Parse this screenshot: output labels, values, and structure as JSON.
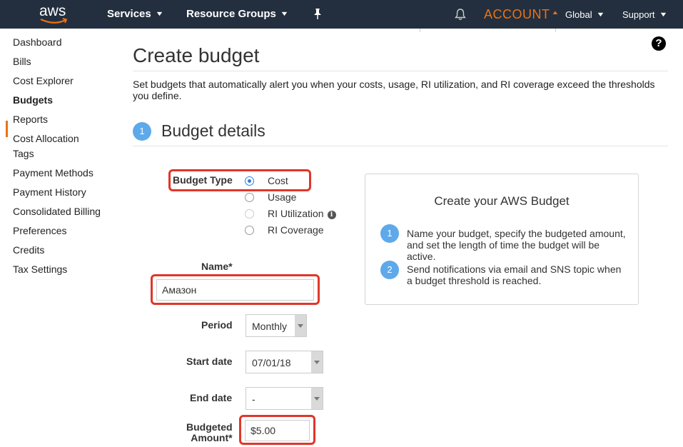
{
  "topnav": {
    "logo_text": "aws",
    "services": "Services",
    "resource_groups": "Resource Groups",
    "account": "ACCOUNT",
    "region": "Global",
    "support": "Support"
  },
  "sidebar": {
    "items": [
      {
        "label": "Dashboard"
      },
      {
        "label": "Bills"
      },
      {
        "label": "Cost Explorer"
      },
      {
        "label": "Budgets",
        "active": true
      },
      {
        "label": "Reports"
      },
      {
        "label": "Cost Allocation Tags"
      },
      {
        "label": "Payment Methods"
      },
      {
        "label": "Payment History"
      },
      {
        "label": "Consolidated Billing"
      },
      {
        "label": "Preferences"
      },
      {
        "label": "Credits"
      },
      {
        "label": "Tax Settings"
      }
    ]
  },
  "help": "?",
  "page": {
    "title": "Create budget",
    "description": "Set budgets that automatically alert you when your costs, usage, RI utilization, and RI coverage exceed the thresholds you define.",
    "section_number": "1",
    "section_title": "Budget details"
  },
  "form": {
    "budget_type_label": "Budget Type",
    "budget_types": [
      {
        "label": "Cost",
        "state": "checked"
      },
      {
        "label": "Usage",
        "state": "unchecked"
      },
      {
        "label": "RI Utilization",
        "state": "disabled"
      },
      {
        "label": "RI Coverage",
        "state": "unchecked"
      }
    ],
    "info_icon": "i",
    "name_label": "Name*",
    "name_value": "Амазон",
    "period_label": "Period",
    "period_value": "Monthly",
    "start_date_label": "Start date",
    "start_date_value": "07/01/18",
    "end_date_label": "End date",
    "end_date_value": "-",
    "budgeted_amount_label_1": "Budgeted",
    "budgeted_amount_label_2": "Amount*",
    "budgeted_amount_value": "$5.00"
  },
  "panel": {
    "title": "Create your AWS Budget",
    "steps": [
      {
        "number": "1",
        "text": "Name your budget, specify the budgeted amount, and set the length of time the budget will be active."
      },
      {
        "number": "2",
        "text": "Send notifications via email and SNS topic when a budget threshold is reached."
      }
    ]
  },
  "colors": {
    "nav_bg": "#232f3e",
    "accent_orange": "#ec7211",
    "step_blue": "#5ea9ea",
    "highlight_red": "#e0362a"
  },
  "icons": [
    "bell-icon",
    "pin-icon",
    "help-icon",
    "info-icon",
    "chevron-down-icon"
  ]
}
